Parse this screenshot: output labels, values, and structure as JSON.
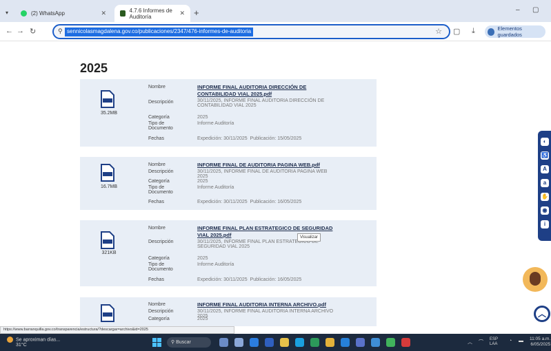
{
  "browser": {
    "tabs": [
      {
        "title": "(2) WhatsApp",
        "active": false
      },
      {
        "title": "4.7.6 Informes de Auditoría",
        "active": true
      }
    ],
    "new_tab": "+",
    "url": "sennicolasmagdalena.gov.co/publicaciones/2347/476-informes-de-auditoria",
    "profile_label": "Elementos guardados",
    "window_controls": {
      "minimize": "–",
      "maximize": "▢"
    }
  },
  "page": {
    "year": "2025",
    "labels": {
      "nombre": "Nombre",
      "descripcion": "Descripción",
      "categoria": "Categoría",
      "tipo_documento": "Tipo de Documento",
      "fechas": "Fechas"
    },
    "documents": [
      {
        "size": "35.2MB",
        "name": "INFORME FINAL AUDITORIA DIRECCIÓN DE CONTABILIDAD VIAL 2025.pdf",
        "description": "30/11/2025, INFORME FINAL AUDITORIA DIRECCIÓN DE CONTABILIDAD VIAL 2025",
        "category": "2025",
        "doc_type": "Informe Auditoría",
        "fechas_label_1": "Expedición: 30/11/2025",
        "fechas_label_2": "Publicación: 15/05/2025"
      },
      {
        "size": "16.7MB",
        "name": "INFORME FINAL DE AUDITORIA PAGINA WEB.pdf",
        "description": "30/11/2025, INFORME FINAL DE AUDITORIA PAGINA WEB 2025",
        "category": "2025",
        "doc_type": "Informe Auditoría",
        "fechas_label_1": "Expedición: 30/11/2025",
        "fechas_label_2": "Publicación: 16/05/2025"
      },
      {
        "size": "321KB",
        "name": "INFORME FINAL PLAN ESTRATEGICO DE SEGURIDAD VIAL 2025.pdf",
        "description": "30/11/2025, INFORME FINAL PLAN ESTRATEGICO DE SEGURIDAD VIAL 2025",
        "category": "2025",
        "doc_type": "Informe Auditoría",
        "fechas_label_1": "Expedición: 30/11/2025",
        "fechas_label_2": "Publicación: 16/05/2025"
      },
      {
        "size": "",
        "name": "INFORME FINAL AUDITORIA INTERNA ARCHIVO.pdf",
        "description": "30/11/2025, INFORME FINAL AUDITORIA INTERNA ARCHIVO 2025",
        "category": "2025"
      }
    ],
    "tooltip": "Visualizar"
  },
  "status_link": "https://www.barranquilla.gov.co/transparencia/estructura/?descargar=archivo&id=2025",
  "taskbar": {
    "weather_line1": "Se aproximan días...",
    "weather_line2": "31°C",
    "search_placeholder": "Buscar",
    "tray_lang": "ESP LAA",
    "clock_time": "11:05 a.m.",
    "clock_date": "6/05/2025"
  },
  "colors": {
    "accent": "#1e3f86",
    "card_bg": "#e8eef6",
    "highlight": "#f3d36b",
    "taskbar": "#1c2a3e"
  },
  "icons": [
    "pdf-file-icon",
    "star-icon",
    "back-icon",
    "forward-icon",
    "reload-icon",
    "accessibility-icon",
    "assistant-avatar-icon",
    "scroll-up-icon",
    "windows-start-icon",
    "search-icon"
  ]
}
